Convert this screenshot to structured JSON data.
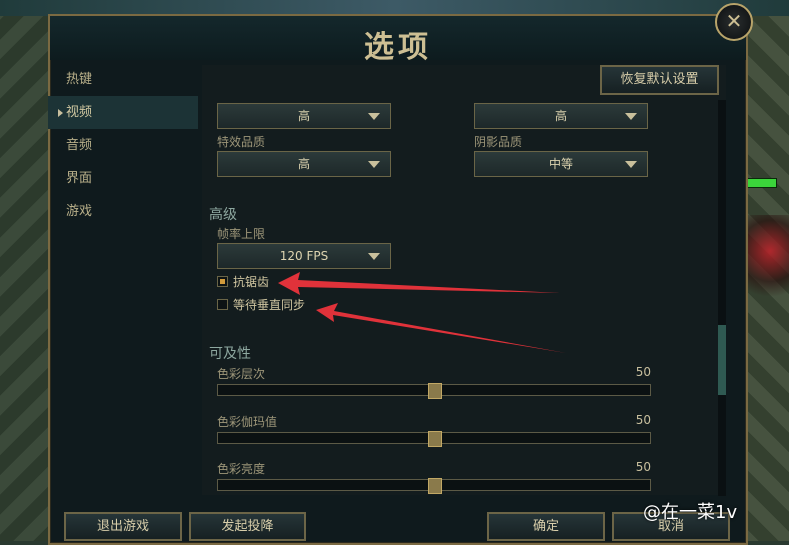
{
  "window": {
    "title": "选项",
    "close_glyph": "✕"
  },
  "sidebar": {
    "items": [
      {
        "label": "热键",
        "active": false
      },
      {
        "label": "视频",
        "active": true
      },
      {
        "label": "音频",
        "active": false
      },
      {
        "label": "界面",
        "active": false
      },
      {
        "label": "游戏",
        "active": false
      }
    ]
  },
  "header": {
    "restore_defaults_label": "恢复默认设置"
  },
  "video": {
    "dropdown_top_left": "高",
    "dropdown_top_right": "高",
    "effects_quality": {
      "label": "特效品质",
      "value": "高"
    },
    "shadow_quality": {
      "label": "阴影品质",
      "value": "中等"
    }
  },
  "advanced": {
    "heading": "高级",
    "frame_rate": {
      "label": "帧率上限",
      "value": "120 FPS"
    },
    "anti_aliasing": {
      "label": "抗锯齿",
      "checked": true
    },
    "vsync": {
      "label": "等待垂直同步",
      "checked": false
    }
  },
  "accessibility": {
    "heading": "可及性",
    "sliders": [
      {
        "label": "色彩层次",
        "value": "50",
        "level": 0.5
      },
      {
        "label": "色彩伽玛值",
        "value": "50",
        "level": 0.5
      },
      {
        "label": "色彩亮度",
        "value": "50",
        "level": 0.5
      }
    ]
  },
  "footer": {
    "exit_game": "退出游戏",
    "surrender": "发起投降",
    "confirm": "确定",
    "cancel": "取消"
  },
  "annotation_color": "#e0323a",
  "watermark": "@在一菜1v"
}
